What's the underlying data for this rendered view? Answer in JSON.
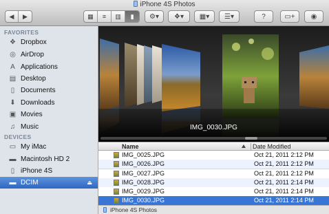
{
  "window": {
    "title": "iPhone 4S Photos"
  },
  "toolbar": {
    "view_modes": [
      "icon",
      "list",
      "column",
      "cover-flow"
    ],
    "active_view": 3
  },
  "sidebar": {
    "favorites_header": "FAVORITES",
    "devices_header": "DEVICES",
    "favorites": [
      {
        "label": "Dropbox",
        "icon": "dropbox-icon"
      },
      {
        "label": "AirDrop",
        "icon": "airdrop-icon"
      },
      {
        "label": "Applications",
        "icon": "applications-icon"
      },
      {
        "label": "Desktop",
        "icon": "desktop-icon"
      },
      {
        "label": "Documents",
        "icon": "documents-icon"
      },
      {
        "label": "Downloads",
        "icon": "downloads-icon"
      },
      {
        "label": "Movies",
        "icon": "movies-icon"
      },
      {
        "label": "Music",
        "icon": "music-icon"
      }
    ],
    "devices": [
      {
        "label": "My iMac",
        "icon": "imac-icon"
      },
      {
        "label": "Macintosh HD 2",
        "icon": "hard-drive-icon"
      },
      {
        "label": "iPhone 4S",
        "icon": "iphone-icon"
      },
      {
        "label": "DCIM",
        "icon": "drive-icon",
        "selected": true
      }
    ]
  },
  "coverflow": {
    "selected_caption": "IMG_0030.JPG"
  },
  "list": {
    "columns": {
      "name": "Name",
      "date": "Date Modified"
    },
    "rows": [
      {
        "name": "IMG_0025.JPG",
        "date": "Oct 21, 2011 2:12 PM"
      },
      {
        "name": "IMG_0026.JPG",
        "date": "Oct 21, 2011 2:12 PM"
      },
      {
        "name": "IMG_0027.JPG",
        "date": "Oct 21, 2011 2:12 PM"
      },
      {
        "name": "IMG_0028.JPG",
        "date": "Oct 21, 2011 2:14 PM"
      },
      {
        "name": "IMG_0029.JPG",
        "date": "Oct 21, 2011 2:14 PM"
      },
      {
        "name": "IMG_0030.JPG",
        "date": "Oct 21, 2011 2:14 PM",
        "selected": true
      }
    ]
  },
  "pathbar": {
    "label": "iPhone 4S Photos"
  }
}
